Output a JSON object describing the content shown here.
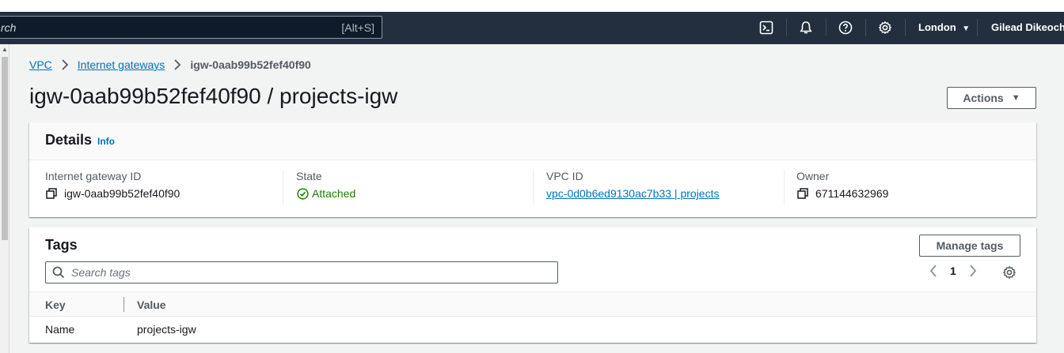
{
  "header": {
    "search_partial": "rch",
    "search_shortcut": "[Alt+S]",
    "icons": [
      "cloudshell-icon",
      "bell-icon",
      "help-icon",
      "settings-icon"
    ],
    "region": "London",
    "user": "Gilead Dikeocha"
  },
  "breadcrumb": {
    "items": [
      "VPC",
      "Internet gateways"
    ],
    "current": "igw-0aab99b52fef40f90"
  },
  "page": {
    "title": "igw-0aab99b52fef40f90 / projects-igw",
    "actions_label": "Actions"
  },
  "details": {
    "title": "Details",
    "info": "Info",
    "fields": [
      {
        "label": "Internet gateway ID",
        "value": "igw-0aab99b52fef40f90"
      },
      {
        "label": "State",
        "value": "Attached"
      },
      {
        "label": "VPC ID",
        "value": "vpc-0d0b6ed9130ac7b33 | projects"
      },
      {
        "label": "Owner",
        "value": "671144632969"
      }
    ]
  },
  "tags": {
    "title": "Tags",
    "manage_label": "Manage tags",
    "search_placeholder": "Search tags",
    "page": "1",
    "columns": [
      "Key",
      "Value"
    ],
    "rows": [
      {
        "key": "Name",
        "value": "projects-igw"
      }
    ]
  },
  "colors": {
    "header_bg": "#232f3e",
    "link": "#0073bb",
    "success": "#1d8102"
  }
}
